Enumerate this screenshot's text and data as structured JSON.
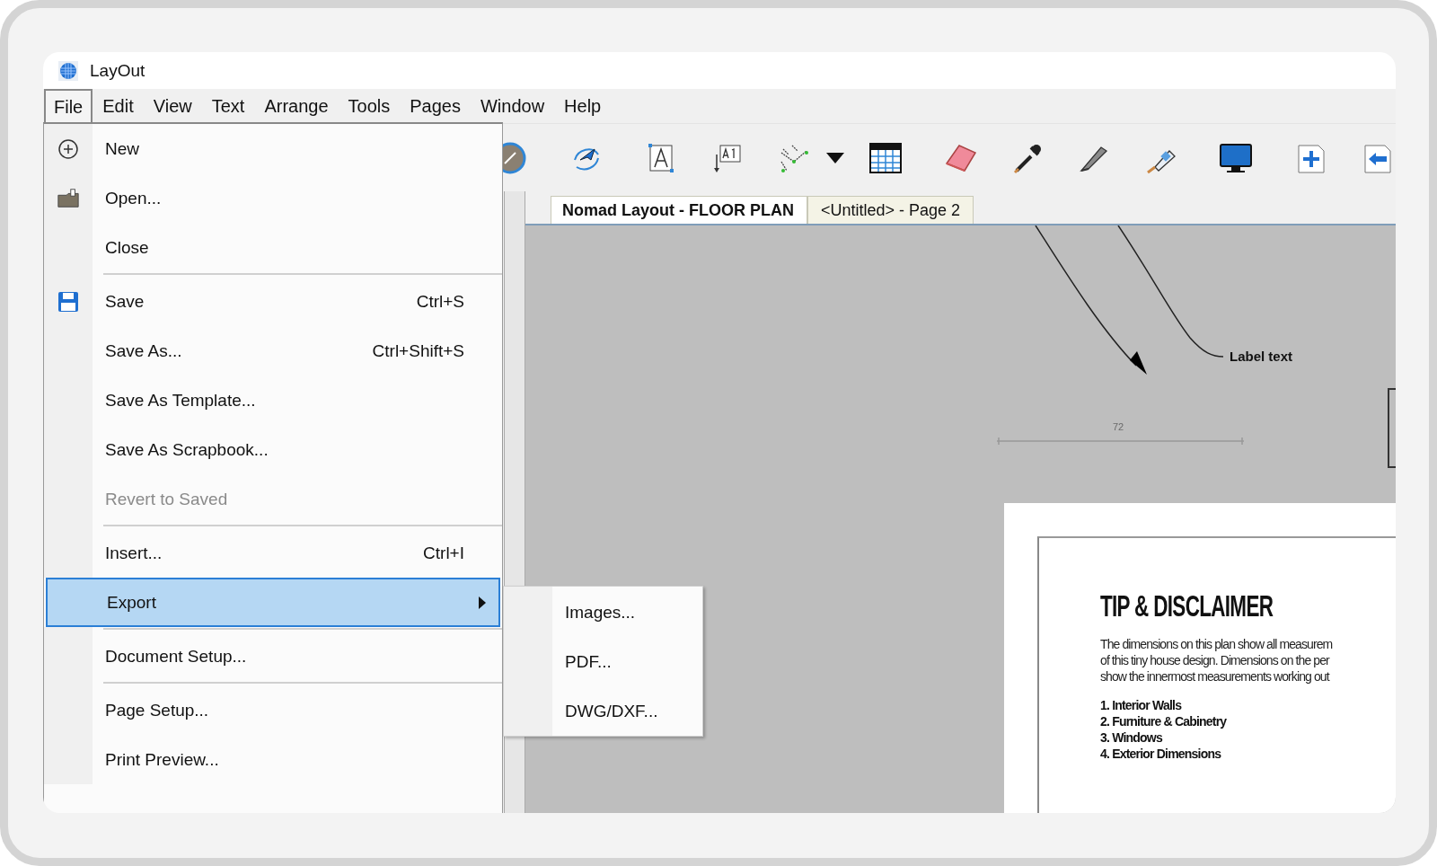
{
  "window": {
    "title": "LayOut"
  },
  "menu_bar": [
    {
      "label": "File",
      "selected": true
    },
    {
      "label": "Edit",
      "selected": false
    },
    {
      "label": "View",
      "selected": false
    },
    {
      "label": "Text",
      "selected": false
    },
    {
      "label": "Arrange",
      "selected": false
    },
    {
      "label": "Tools",
      "selected": false
    },
    {
      "label": "Pages",
      "selected": false
    },
    {
      "label": "Window",
      "selected": false
    },
    {
      "label": "Help",
      "selected": false
    }
  ],
  "file_menu": {
    "items": [
      {
        "kind": "item",
        "label": "New",
        "disabled": false,
        "selected": false
      },
      {
        "kind": "item",
        "label": "Open...",
        "disabled": false,
        "selected": false
      },
      {
        "kind": "item",
        "label": "Close",
        "disabled": false,
        "selected": false
      },
      {
        "kind": "separator"
      },
      {
        "kind": "item",
        "label": "Save",
        "shortcut": "Ctrl+S",
        "disabled": false,
        "selected": false
      },
      {
        "kind": "item",
        "label": "Save As...",
        "shortcut": "Ctrl+Shift+S",
        "disabled": false,
        "selected": false
      },
      {
        "kind": "item",
        "label": "Save As Template...",
        "disabled": false,
        "selected": false
      },
      {
        "kind": "item",
        "label": "Save As Scrapbook...",
        "disabled": false,
        "selected": false
      },
      {
        "kind": "item",
        "label": "Revert to Saved",
        "disabled": true,
        "selected": false
      },
      {
        "kind": "separator"
      },
      {
        "kind": "item",
        "label": "Insert...",
        "shortcut": "Ctrl+I",
        "disabled": false,
        "selected": false
      },
      {
        "kind": "item",
        "label": "Export",
        "disabled": false,
        "selected": true,
        "submenu": {
          "items": [
            {
              "label": "Images..."
            },
            {
              "label": "PDF..."
            },
            {
              "label": "DWG/DXF..."
            }
          ]
        }
      },
      {
        "kind": "separator"
      },
      {
        "kind": "item",
        "label": "Document Setup...",
        "disabled": false,
        "selected": false
      },
      {
        "kind": "separator"
      },
      {
        "kind": "item",
        "label": "Page Setup...",
        "disabled": false,
        "selected": false
      },
      {
        "kind": "item",
        "label": "Print Preview...",
        "disabled": false,
        "selected": false
      }
    ]
  },
  "tabs": [
    {
      "label": "Nomad Layout - FLOOR PLAN",
      "selected": true
    },
    {
      "label": "<Untitled> - Page 2",
      "selected": false
    }
  ],
  "canvas": {
    "label_text": "Label text",
    "dimension": "72",
    "page": {
      "title": "TIP & DISCLAIMER",
      "paragraph_lines": [
        "The dimensions on this plan show all measurem",
        "of this tiny house design. Dimensions on the per",
        "show the innermost measurements working out"
      ],
      "list": [
        "1. Interior Walls",
        "2. Furniture & Cabinetry",
        "3. Windows",
        "4. Exterior Dimensions"
      ]
    }
  }
}
